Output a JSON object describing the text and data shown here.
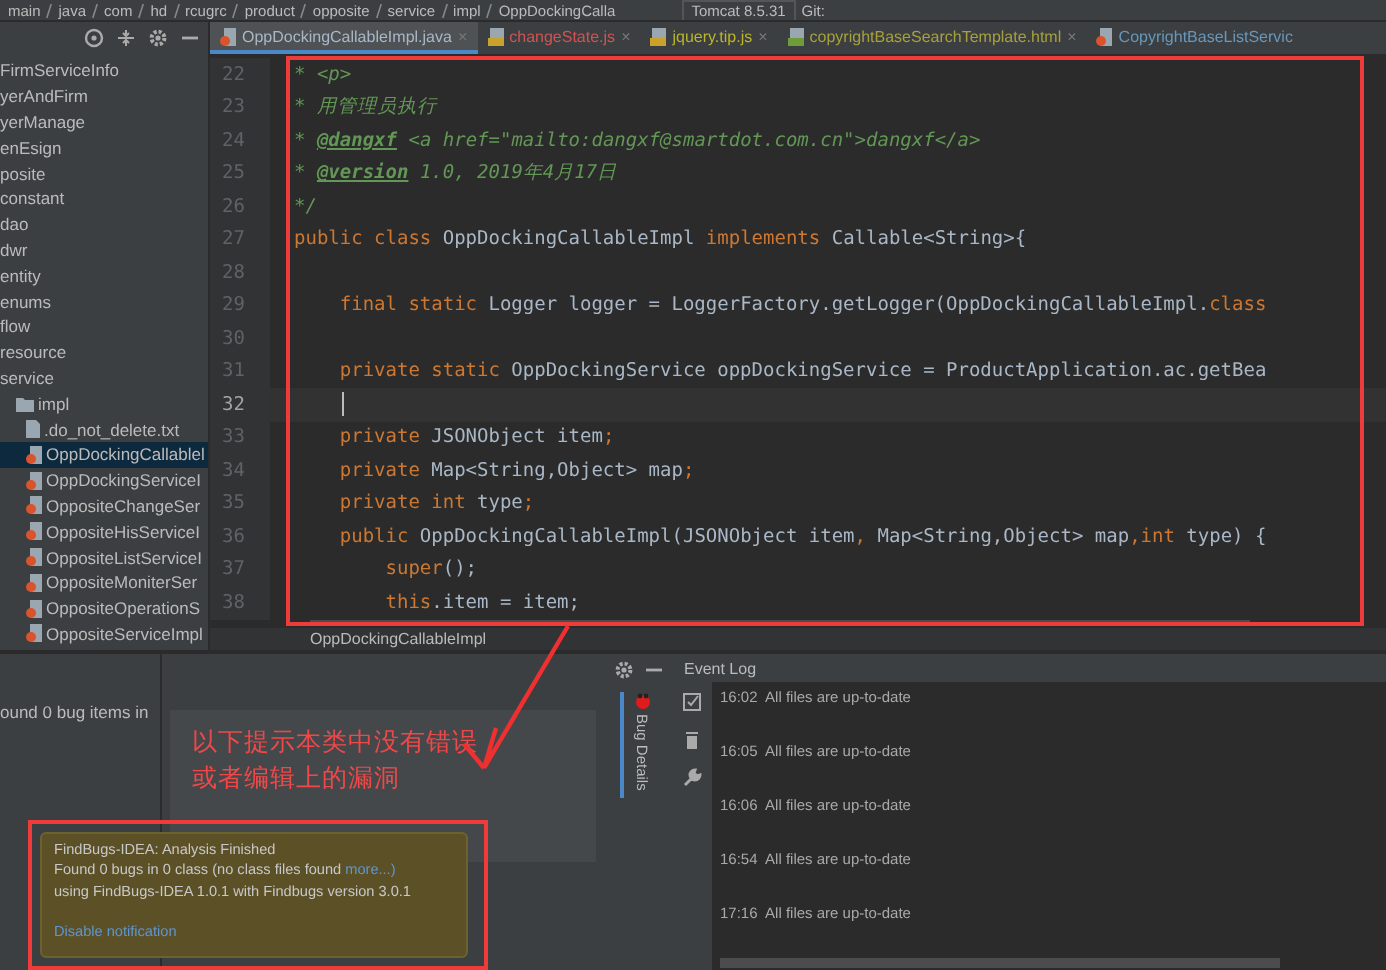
{
  "breadcrumbs": [
    "main",
    "java",
    "com",
    "hd",
    "rcugrc",
    "product",
    "opposite",
    "service",
    "impl",
    "OppDockingCalla"
  ],
  "run_config": "Tomcat 8.5.31",
  "vcs_label": "Git:",
  "project_tree": [
    {
      "label": "FirmServiceInfo",
      "selected": false
    },
    {
      "label": "yerAndFirm",
      "selected": false
    },
    {
      "label": "yerManage",
      "selected": false
    },
    {
      "label": "enEsign",
      "selected": false
    },
    {
      "label": "posite",
      "selected": false
    },
    {
      "label": "constant",
      "selected": false
    },
    {
      "label": "dao",
      "selected": false
    },
    {
      "label": "dwr",
      "selected": false
    },
    {
      "label": "entity",
      "selected": false
    },
    {
      "label": "enums",
      "selected": false
    },
    {
      "label": "flow",
      "selected": false
    },
    {
      "label": "resource",
      "selected": false
    },
    {
      "label": "service",
      "selected": false,
      "children": [
        {
          "label": "impl",
          "kind": "folder",
          "selected": false,
          "children": [
            {
              "label": ".do_not_delete.txt",
              "kind": "text",
              "selected": false
            },
            {
              "label": "OppDockingCallablel",
              "kind": "java",
              "selected": true
            },
            {
              "label": "OppDockingServiceI",
              "kind": "java",
              "selected": false
            },
            {
              "label": "OppositeChangeSer",
              "kind": "java",
              "selected": false
            },
            {
              "label": "OppositeHisServiceI",
              "kind": "java",
              "selected": false
            },
            {
              "label": "OppositeListServiceI",
              "kind": "java",
              "selected": false
            },
            {
              "label": "OppositeMoniterSer",
              "kind": "java",
              "selected": false
            },
            {
              "label": "OppositeOperationS",
              "kind": "java",
              "selected": false
            },
            {
              "label": "OppositeServiceImpl",
              "kind": "java",
              "selected": false
            }
          ]
        }
      ]
    }
  ],
  "tabs": [
    {
      "label": "OppDockingCallableImpl.java",
      "kind": "java",
      "color": "#a9b7c6",
      "selected": true,
      "close": "×"
    },
    {
      "label": "changeState.js",
      "kind": "js",
      "color": "#d25252",
      "selected": false,
      "close": "×"
    },
    {
      "label": "jquery.tip.js",
      "kind": "js",
      "color": "#bbb529",
      "selected": false,
      "close": "×"
    },
    {
      "label": "copyrightBaseSearchTemplate.html",
      "kind": "html",
      "color": "#a8a03c",
      "selected": false,
      "close": "×"
    },
    {
      "label": "CopyrightBaseListServic",
      "kind": "java",
      "color": "#6897bb",
      "selected": false
    }
  ],
  "code_lines": [
    {
      "number": "22",
      "current": false,
      "tokens": [
        {
          "kind": "comment",
          "text": "* <p>"
        }
      ]
    },
    {
      "number": "23",
      "current": false,
      "tokens": [
        {
          "kind": "comment",
          "text": "* 用管理员执行"
        }
      ]
    },
    {
      "number": "24",
      "current": false,
      "tokens": [
        {
          "kind": "comment",
          "text": "* "
        },
        {
          "kind": "doctag",
          "text": "@dangxf"
        },
        {
          "kind": "comment",
          "text": " <a href=\"mailto:dangxf@smartdot.com.cn\">dangxf</a>"
        }
      ]
    },
    {
      "number": "25",
      "current": false,
      "tokens": [
        {
          "kind": "comment",
          "text": "* "
        },
        {
          "kind": "doctag",
          "text": "@version"
        },
        {
          "kind": "comment",
          "text": " 1.0, 2019年4月17日"
        }
      ]
    },
    {
      "number": "26",
      "current": false,
      "tokens": [
        {
          "kind": "comment",
          "text": "*/"
        }
      ]
    },
    {
      "number": "27",
      "current": false,
      "tokens": [
        {
          "kind": "keyword",
          "text": "public class "
        },
        {
          "kind": "plain",
          "text": "OppDockingCallableImpl "
        },
        {
          "kind": "keyword",
          "text": "implements "
        },
        {
          "kind": "plain",
          "text": "Callable<String>{"
        }
      ]
    },
    {
      "number": "28",
      "current": false
    },
    {
      "number": "29",
      "current": false,
      "tokens": [
        {
          "kind": "keyword",
          "text": "    final static "
        },
        {
          "kind": "plain",
          "text": "Logger logger = LoggerFactory.getLogger(OppDockingCallableImpl."
        },
        {
          "kind": "keyword",
          "text": "class"
        }
      ]
    },
    {
      "number": "30",
      "current": false
    },
    {
      "number": "31",
      "current": false,
      "tokens": [
        {
          "kind": "keyword",
          "text": "    private static "
        },
        {
          "kind": "plain",
          "text": "OppDockingService oppDockingService = ProductApplication.ac.getBea"
        }
      ]
    },
    {
      "number": "32",
      "current": true
    },
    {
      "number": "33",
      "current": false,
      "tokens": [
        {
          "kind": "keyword",
          "text": "    private "
        },
        {
          "kind": "plain",
          "text": "JSONObject item"
        },
        {
          "kind": "keyword",
          "text": ";"
        }
      ]
    },
    {
      "number": "34",
      "current": false,
      "tokens": [
        {
          "kind": "keyword",
          "text": "    private "
        },
        {
          "kind": "plain",
          "text": "Map<String,Object> map"
        },
        {
          "kind": "keyword",
          "text": ";"
        }
      ]
    },
    {
      "number": "35",
      "current": false,
      "tokens": [
        {
          "kind": "keyword",
          "text": "    private int "
        },
        {
          "kind": "plain",
          "text": "type"
        },
        {
          "kind": "keyword",
          "text": ";"
        }
      ]
    },
    {
      "number": "36",
      "current": false,
      "tokens": [
        {
          "kind": "keyword",
          "text": "    public "
        },
        {
          "kind": "plain",
          "text": "OppDockingCallableImpl(JSONObject item"
        },
        {
          "kind": "keyword",
          "text": ", "
        },
        {
          "kind": "plain",
          "text": "Map<String,Object> map"
        },
        {
          "kind": "keyword",
          "text": ",int "
        },
        {
          "kind": "plain",
          "text": "type) {"
        }
      ]
    },
    {
      "number": "37",
      "current": false,
      "tokens": [
        {
          "kind": "keyword",
          "text": "        super"
        },
        {
          "kind": "plain",
          "text": "();"
        }
      ]
    },
    {
      "number": "38",
      "current": false,
      "tokens": [
        {
          "kind": "keyword",
          "text": "        this"
        },
        {
          "kind": "plain",
          "text": ".item = item;"
        }
      ]
    }
  ],
  "editor_breadcrumb": "OppDockingCallableImpl",
  "findbugs": {
    "summary": "ound 0 bug items in",
    "side_tab": "Bug Details"
  },
  "annotation": {
    "lines": [
      "以下提示本类中没有错误",
      "或者编辑上的漏洞"
    ]
  },
  "event_log": {
    "title": "Event Log",
    "entries": [
      {
        "time": "16:02",
        "message": "All files are up-to-date"
      },
      {
        "time": "16:05",
        "message": "All files are up-to-date"
      },
      {
        "time": "16:06",
        "message": "All files are up-to-date"
      },
      {
        "time": "16:54",
        "message": "All files are up-to-date"
      },
      {
        "time": "17:16",
        "message": "All files are up-to-date"
      }
    ]
  },
  "notification": {
    "title": "FindBugs-IDEA: Analysis Finished",
    "line_1": "Found 0 bugs in 0 class  (no class files found ",
    "line_1_link": "more...)",
    "line_2": "using FindBugs-IDEA 1.0.1 with Findbugs version 3.0.1",
    "action": "Disable notification"
  }
}
